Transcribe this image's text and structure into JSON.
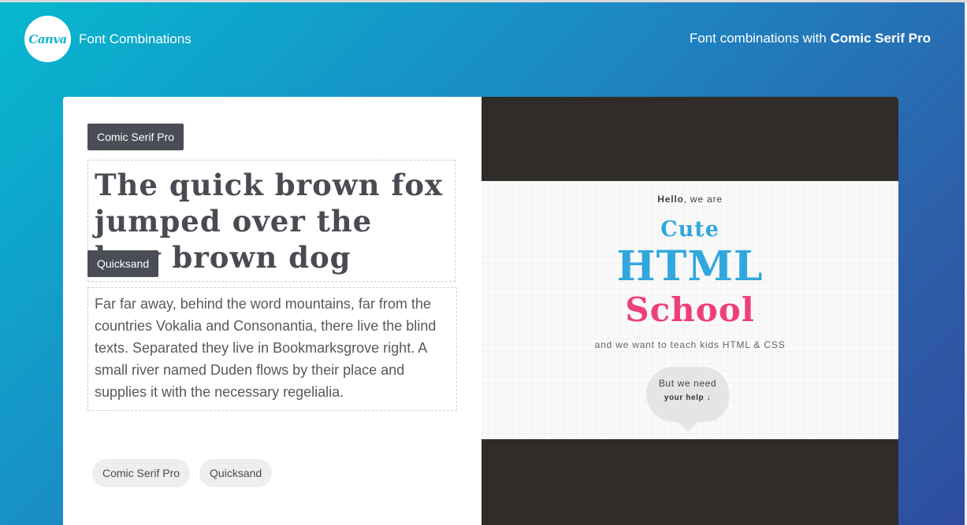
{
  "header": {
    "logo_text": "Canva",
    "title": "Font Combinations",
    "right_prefix": "Font combinations with",
    "right_font": "Comic Serif Pro"
  },
  "editor": {
    "heading_tag": "Comic Serif Pro",
    "body_tag": "Quicksand",
    "heading_text": "The quick brown fox jumped over the lazy brown dog",
    "body_text": "Far far away, behind the word mountains, far from the countries Vokalia and Consonantia, there live the blind texts. Separated they live in Bookmarksgrove right. A small river named Duden flows by their place and supplies it with the necessary regelialia."
  },
  "font_pills": [
    "Comic Serif Pro",
    "Quicksand"
  ],
  "preview": {
    "hello_bold": "Hello",
    "hello_rest": ", we are",
    "line1": "Cute",
    "line2": "HTML",
    "line3": "School",
    "tagline": "and we want to teach kids HTML & CSS",
    "bubble_line1": "But we need",
    "bubble_line2": "your help ↓"
  },
  "colors": {
    "brand": "#00c4cc",
    "accent_blue": "#31a7de",
    "accent_pink": "#ef3f7b",
    "tag_bg": "#4b4d56",
    "preview_dark": "#2f2c29"
  }
}
